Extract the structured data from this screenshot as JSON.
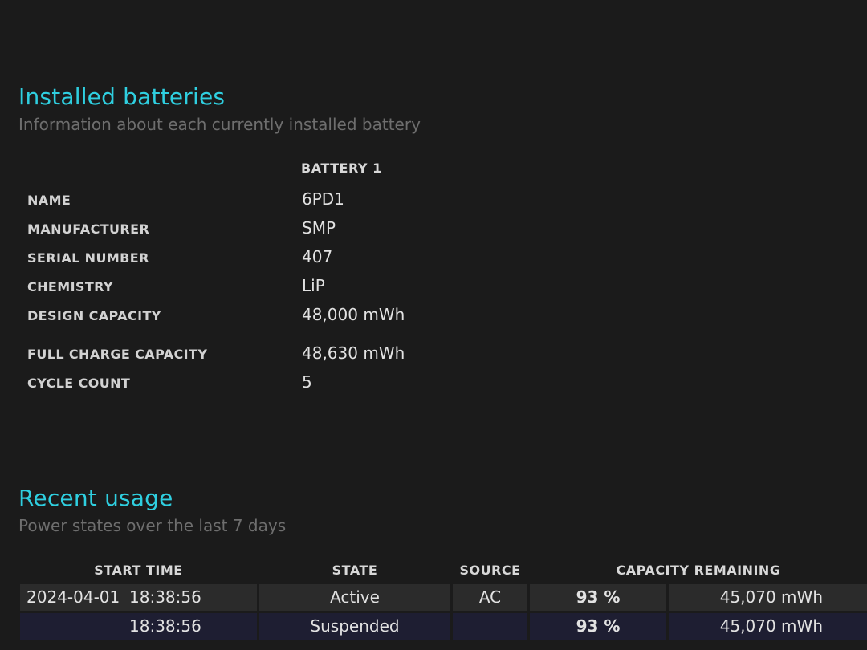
{
  "installed": {
    "title": "Installed batteries",
    "subtitle": "Information about each currently installed battery",
    "column_header": "BATTERY 1",
    "rows": [
      {
        "label": "NAME",
        "value": "6PD1"
      },
      {
        "label": "MANUFACTURER",
        "value": "SMP"
      },
      {
        "label": "SERIAL NUMBER",
        "value": "407"
      },
      {
        "label": "CHEMISTRY",
        "value": "LiP"
      },
      {
        "label": "DESIGN CAPACITY",
        "value": "48,000 mWh"
      },
      {
        "label": "FULL CHARGE CAPACITY",
        "value": "48,630 mWh"
      },
      {
        "label": "CYCLE COUNT",
        "value": "5"
      }
    ]
  },
  "usage": {
    "title": "Recent usage",
    "subtitle": "Power states over the last 7 days",
    "headers": {
      "start_time": "START TIME",
      "state": "STATE",
      "source": "SOURCE",
      "capacity_remaining": "CAPACITY REMAINING"
    },
    "rows": [
      {
        "date": "2024-04-01",
        "time": "18:38:56",
        "state": "Active",
        "source": "AC",
        "percent": "93 %",
        "capacity": "45,070 mWh"
      },
      {
        "date": "",
        "time": "18:38:56",
        "state": "Suspended",
        "source": "",
        "percent": "93 %",
        "capacity": "45,070 mWh"
      }
    ]
  }
}
